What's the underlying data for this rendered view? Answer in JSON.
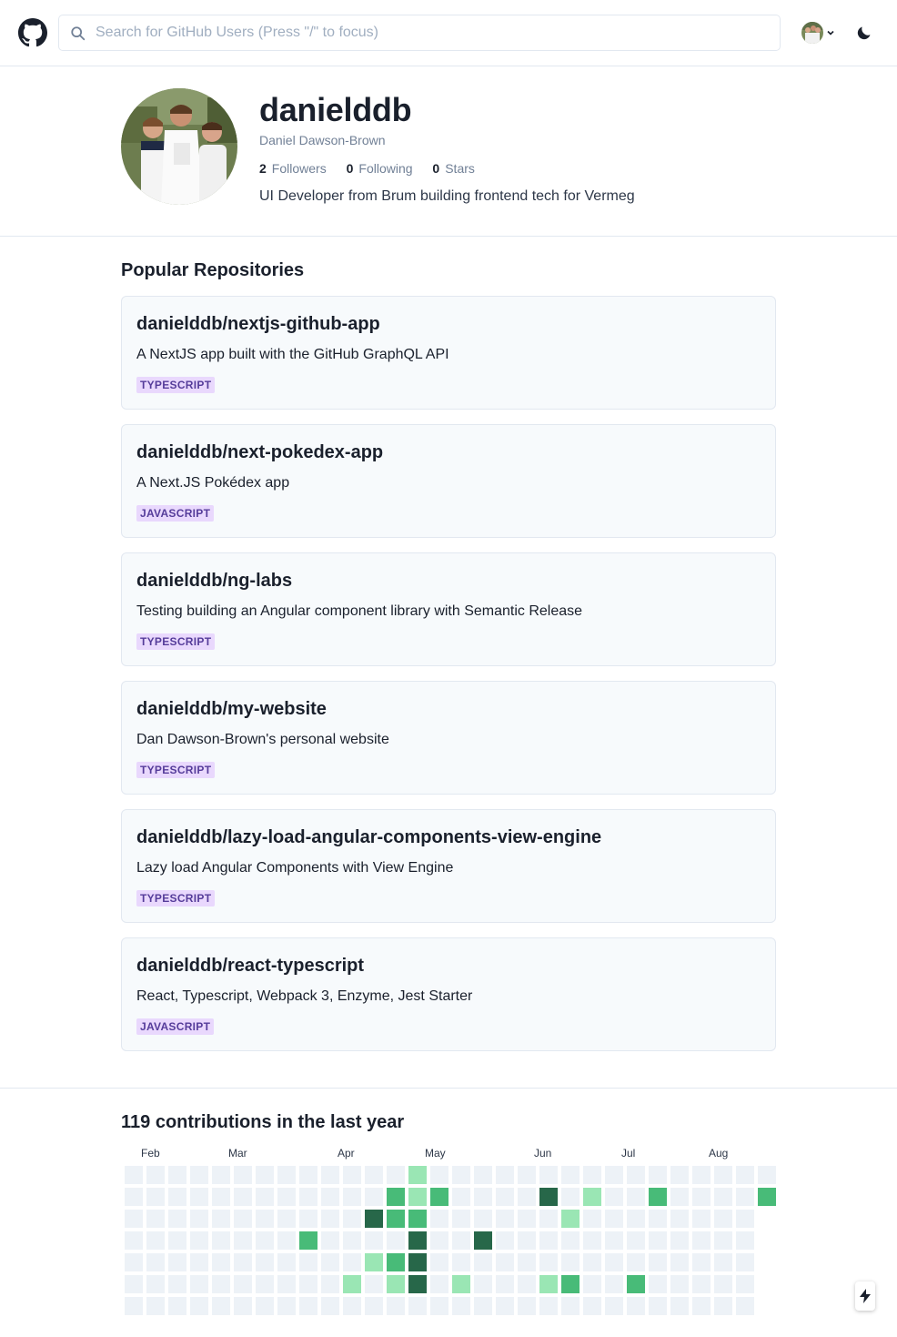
{
  "header": {
    "search_placeholder": "Search for GitHub Users (Press \"/\" to focus)",
    "icons": [
      "github-logo-icon",
      "search-icon",
      "chevron-down-icon",
      "moon-icon"
    ]
  },
  "profile": {
    "username": "danielddb",
    "full_name": "Daniel Dawson-Brown",
    "followers_count": "2",
    "followers_label": "Followers",
    "following_count": "0",
    "following_label": "Following",
    "stars_count": "0",
    "stars_label": "Stars",
    "bio": "UI Developer from Brum building frontend tech for Vermeg"
  },
  "repositories": {
    "title": "Popular Repositories",
    "items": [
      {
        "name": "danielddb/nextjs-github-app",
        "description": "A NextJS app built with the GitHub GraphQL API",
        "language": "TYPESCRIPT"
      },
      {
        "name": "danielddb/next-pokedex-app",
        "description": "A Next.JS Pokédex app",
        "language": "JAVASCRIPT"
      },
      {
        "name": "danielddb/ng-labs",
        "description": "Testing building an Angular component library with Semantic Release",
        "language": "TYPESCRIPT"
      },
      {
        "name": "danielddb/my-website",
        "description": "Dan Dawson-Brown's personal website",
        "language": "TYPESCRIPT"
      },
      {
        "name": "danielddb/lazy-load-angular-components-view-engine",
        "description": "Lazy load Angular Components with View Engine",
        "language": "TYPESCRIPT"
      },
      {
        "name": "danielddb/react-typescript",
        "description": "React, Typescript, Webpack 3, Enzyme, Jest Starter",
        "language": "JAVASCRIPT"
      }
    ]
  },
  "contributions": {
    "title": "119 contributions in the last year",
    "months": [
      {
        "label": "Feb",
        "week": 1
      },
      {
        "label": "Mar",
        "week": 5
      },
      {
        "label": "Apr",
        "week": 10
      },
      {
        "label": "May",
        "week": 14
      },
      {
        "label": "Jun",
        "week": 19
      },
      {
        "label": "Jul",
        "week": 23
      },
      {
        "label": "Aug",
        "week": 27
      }
    ],
    "weeks": 30,
    "last_week_days": 2,
    "colors": {
      "empty": "#edf2f7",
      "low": "#9ae6b4",
      "mid": "#48bb78",
      "high": "#276749"
    },
    "active_days": [
      {
        "week": 8,
        "day": 3,
        "level": 2
      },
      {
        "week": 10,
        "day": 5,
        "level": 1
      },
      {
        "week": 11,
        "day": 2,
        "level": 3
      },
      {
        "week": 11,
        "day": 4,
        "level": 1
      },
      {
        "week": 12,
        "day": 1,
        "level": 2
      },
      {
        "week": 12,
        "day": 2,
        "level": 2
      },
      {
        "week": 12,
        "day": 4,
        "level": 2
      },
      {
        "week": 12,
        "day": 5,
        "level": 1
      },
      {
        "week": 13,
        "day": 0,
        "level": 1
      },
      {
        "week": 13,
        "day": 1,
        "level": 1
      },
      {
        "week": 13,
        "day": 2,
        "level": 2
      },
      {
        "week": 13,
        "day": 3,
        "level": 3
      },
      {
        "week": 13,
        "day": 4,
        "level": 3
      },
      {
        "week": 13,
        "day": 5,
        "level": 3
      },
      {
        "week": 14,
        "day": 1,
        "level": 2
      },
      {
        "week": 15,
        "day": 5,
        "level": 1
      },
      {
        "week": 16,
        "day": 3,
        "level": 3
      },
      {
        "week": 19,
        "day": 1,
        "level": 3
      },
      {
        "week": 19,
        "day": 5,
        "level": 1
      },
      {
        "week": 20,
        "day": 2,
        "level": 1
      },
      {
        "week": 20,
        "day": 5,
        "level": 2
      },
      {
        "week": 21,
        "day": 1,
        "level": 1
      },
      {
        "week": 23,
        "day": 5,
        "level": 2
      },
      {
        "week": 24,
        "day": 1,
        "level": 2
      },
      {
        "week": 29,
        "day": 1,
        "level": 2
      }
    ]
  }
}
